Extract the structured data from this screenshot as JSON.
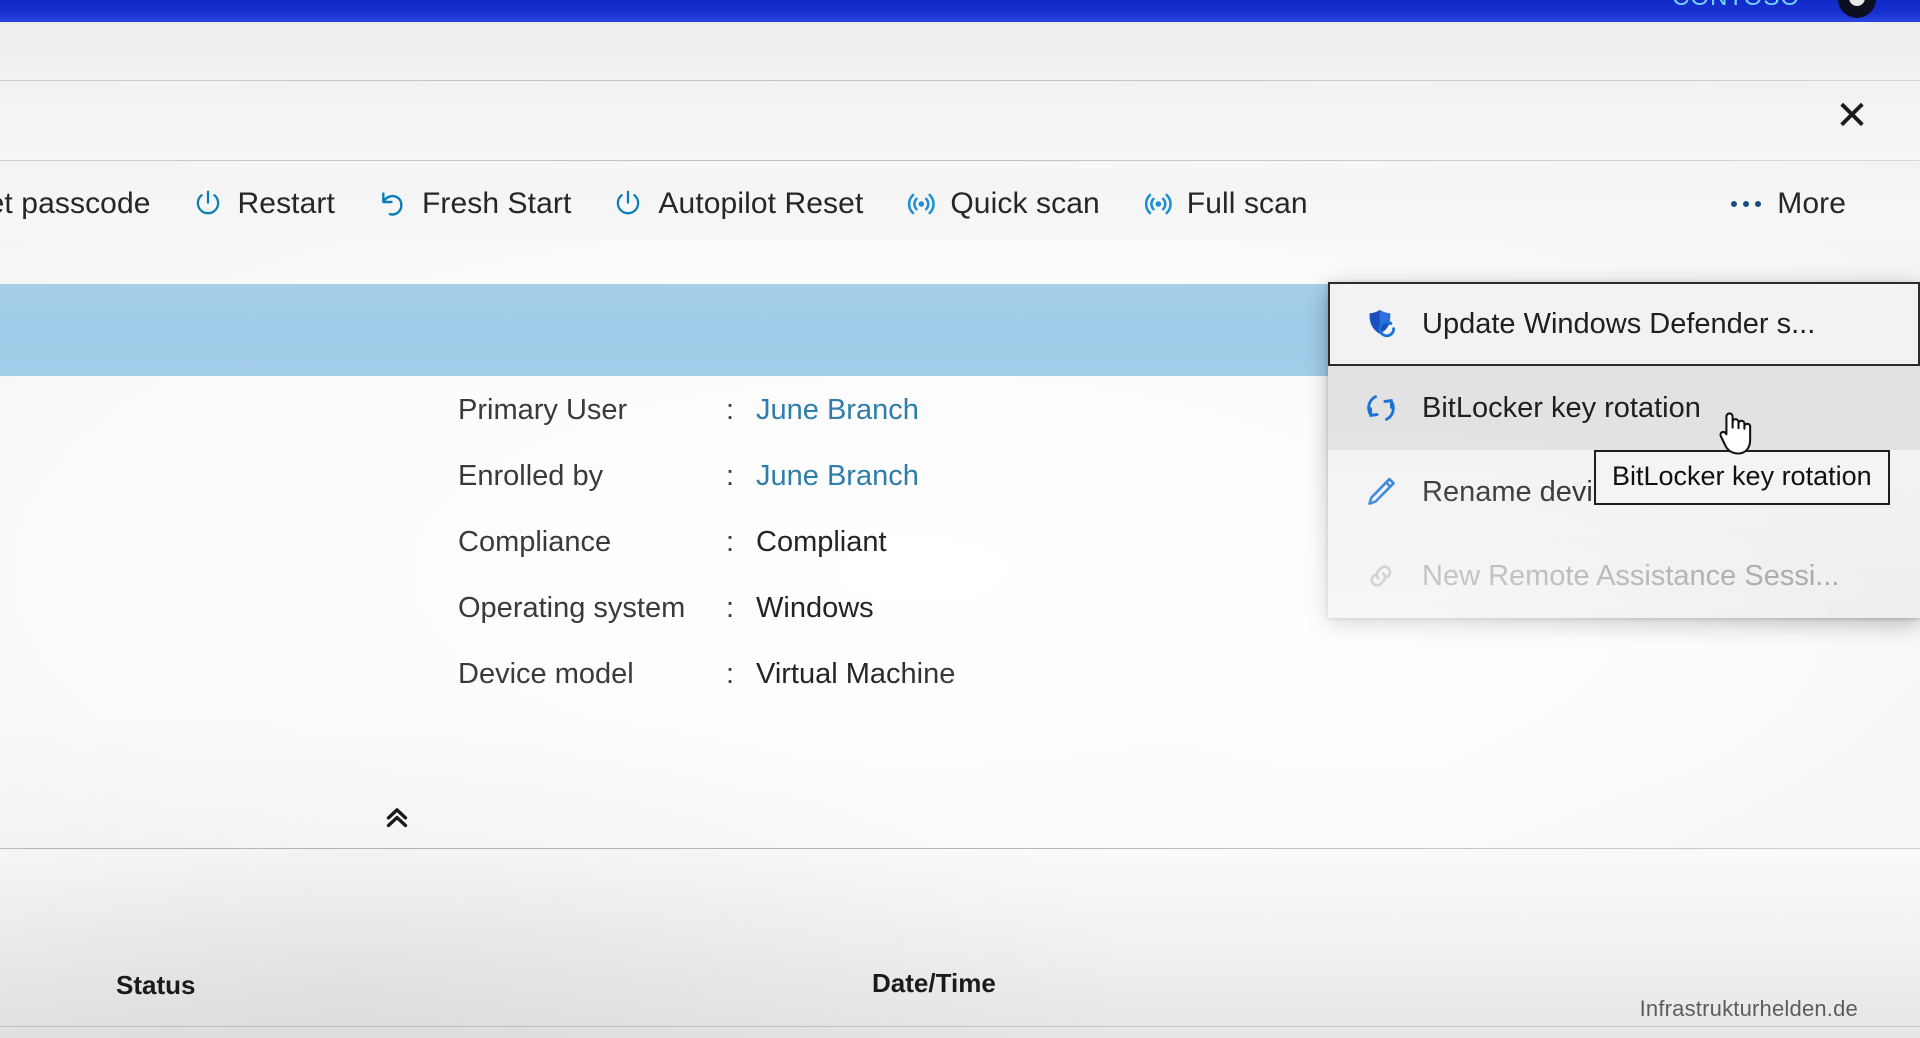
{
  "banner": {
    "org_name": "CONTOSO",
    "avatar_icon": "user-avatar-icon"
  },
  "window": {
    "close_label": "✕"
  },
  "action_bar": {
    "items": [
      {
        "label": "Reset passcode",
        "icon": "key-icon",
        "truncated_left": true
      },
      {
        "label": "Restart",
        "icon": "power-icon"
      },
      {
        "label": "Fresh Start",
        "icon": "undo-arrow-icon"
      },
      {
        "label": "Autopilot Reset",
        "icon": "power-icon"
      },
      {
        "label": "Quick scan",
        "icon": "radar-scan-icon"
      },
      {
        "label": "Full scan",
        "icon": "radar-scan-icon"
      }
    ],
    "more": {
      "label": "More",
      "icon": "ellipsis-icon"
    }
  },
  "more_menu": {
    "items": [
      {
        "label": "Update Windows Defender s...",
        "icon": "defender-shield-refresh-icon",
        "state": "focused"
      },
      {
        "label": "BitLocker key rotation",
        "icon": "rotate-key-icon",
        "state": "hovered"
      },
      {
        "label": "Rename device",
        "icon": "pencil-icon",
        "state": "normal"
      },
      {
        "label": "New Remote Assistance Sessi...",
        "icon": "link-chain-icon",
        "state": "disabled"
      }
    ]
  },
  "tooltip": {
    "text": "BitLocker key rotation"
  },
  "device_details": {
    "rows": [
      {
        "label": "Primary User",
        "separator": ":",
        "value": "June Branch",
        "is_link": true
      },
      {
        "label": "Enrolled by",
        "separator": ":",
        "value": "June Branch",
        "is_link": true
      },
      {
        "label": "Compliance",
        "separator": ":",
        "value": "Compliant",
        "is_link": false
      },
      {
        "label": "Operating system",
        "separator": ":",
        "value": "Windows",
        "is_link": false
      },
      {
        "label": "Device model",
        "separator": ":",
        "value": "Virtual Machine",
        "is_link": false
      }
    ],
    "collapse_icon": "double-chevron-up-icon"
  },
  "table": {
    "columns": [
      {
        "label": "Status"
      },
      {
        "label": "Date/Time"
      }
    ]
  },
  "watermark": {
    "text": "Infrastrukturhelden.de"
  },
  "colors": {
    "banner_blue": "#1730cf",
    "org_text": "#72d4ff",
    "selected_row": "#9ecbe8",
    "icon_accent": "#0b7fb5",
    "link_text": "#2e7dab",
    "menu_bg": "#f2f2f2",
    "hover_bg": "#e2e2e2",
    "disabled_text": "#a3a3a3"
  },
  "cursor": {
    "type": "pointing-hand"
  }
}
